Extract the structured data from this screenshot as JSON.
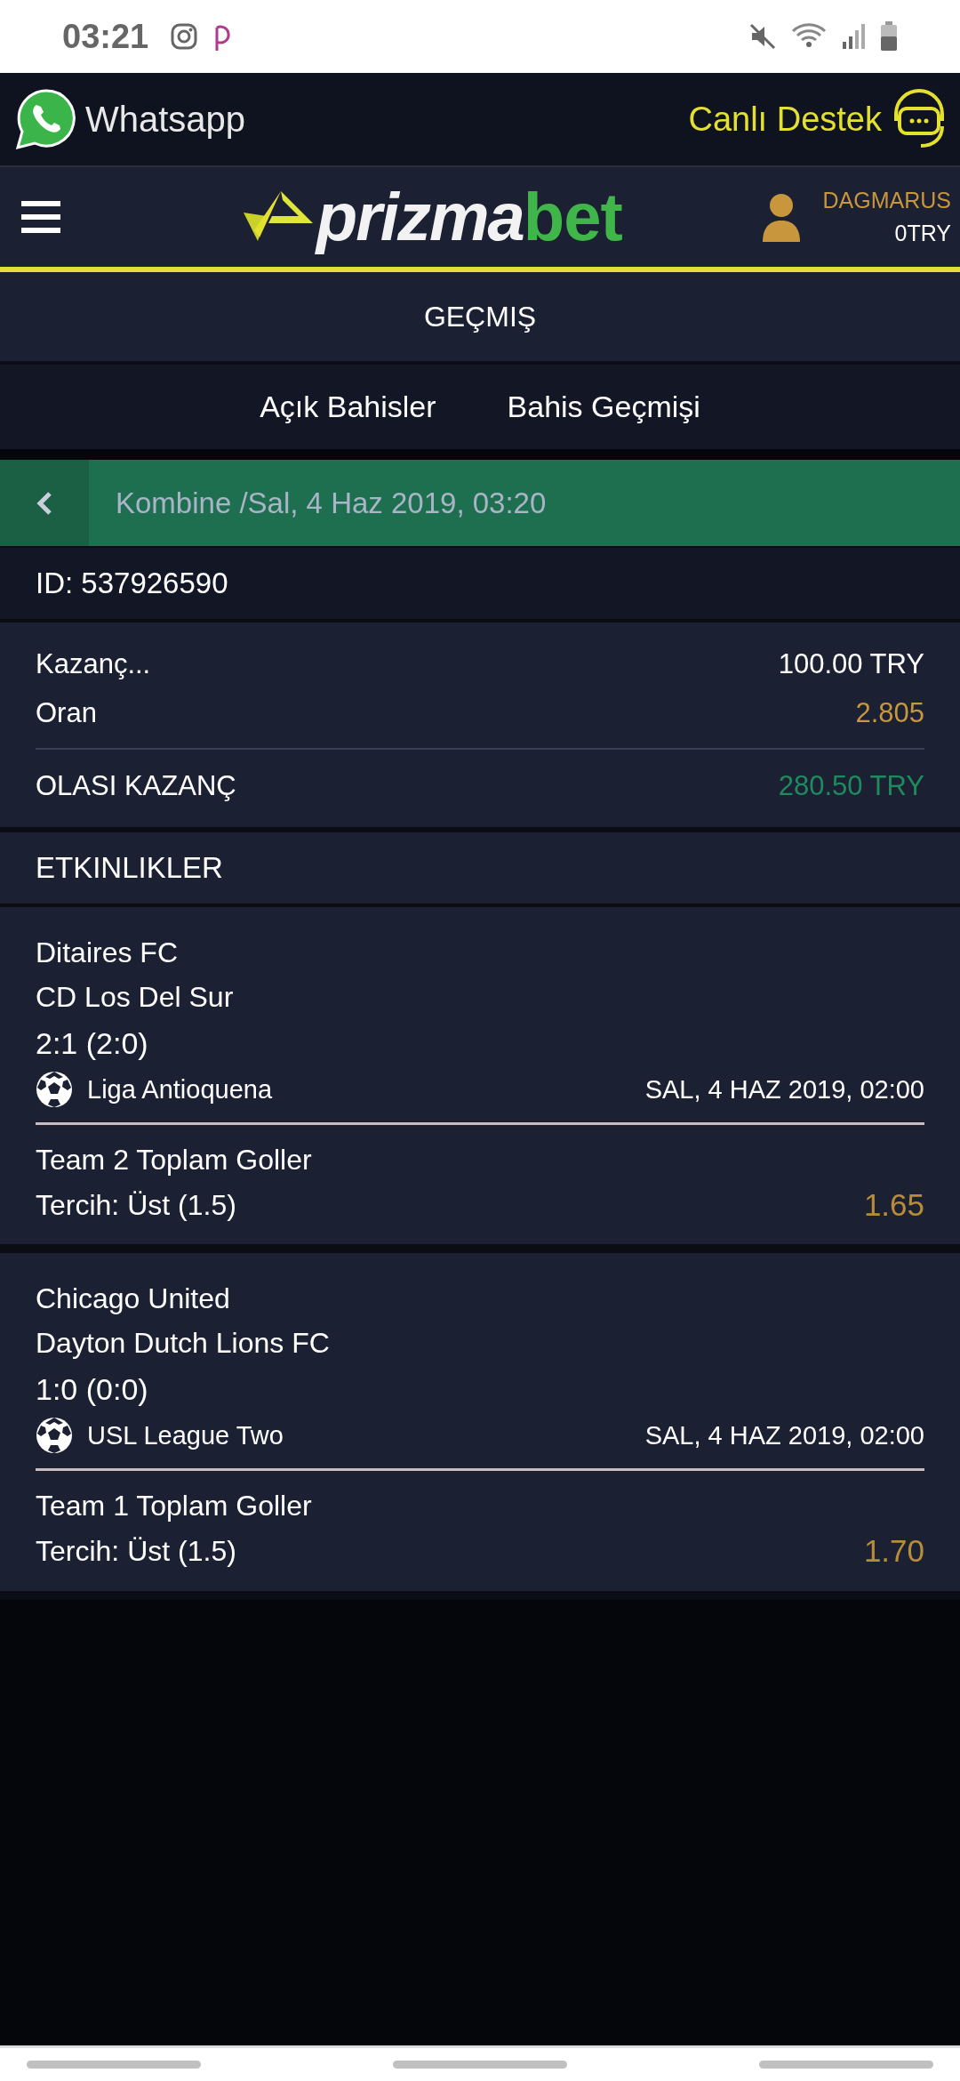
{
  "status_bar": {
    "time": "03:21"
  },
  "top_bar": {
    "whatsapp": "Whatsapp",
    "support": "Canlı Destek"
  },
  "header": {
    "logo_left": "prizma",
    "logo_right": "bet",
    "username": "DAGMARUS",
    "balance": "0TRY"
  },
  "page_title": "GEÇMIŞ",
  "tabs": [
    {
      "label": "Açık Bahisler"
    },
    {
      "label": "Bahis Geçmişi"
    }
  ],
  "bet": {
    "title": "Kombine /Sal, 4 Haz 2019, 03:20",
    "id": "ID: 537926590",
    "summary": [
      {
        "label": "Kazanç...",
        "value": "100.00 TRY",
        "kind": "plain"
      },
      {
        "label": "Oran",
        "value": "2.805",
        "kind": "odds"
      },
      {
        "label": "OLASI KAZANÇ",
        "value": "280.50 TRY",
        "kind": "win"
      }
    ]
  },
  "events_title": "ETKINLIKLER",
  "events": [
    {
      "team1": "Ditaires FC",
      "team2": "CD Los Del Sur",
      "score": "2:1 (2:0)",
      "league": "Liga Antioquena",
      "date": "SAL, 4 HAZ 2019, 02:00",
      "market": "Team 2 Toplam Goller",
      "pick": "Tercih: Üst (1.5)",
      "odds": "1.65"
    },
    {
      "team1": "Chicago United",
      "team2": "Dayton Dutch Lions FC",
      "score": "1:0 (0:0)",
      "league": "USL League Two",
      "date": "SAL, 4 HAZ 2019, 02:00",
      "market": "Team 1 Toplam Goller",
      "pick": "Tercih: Üst (1.5)",
      "odds": "1.70"
    }
  ]
}
